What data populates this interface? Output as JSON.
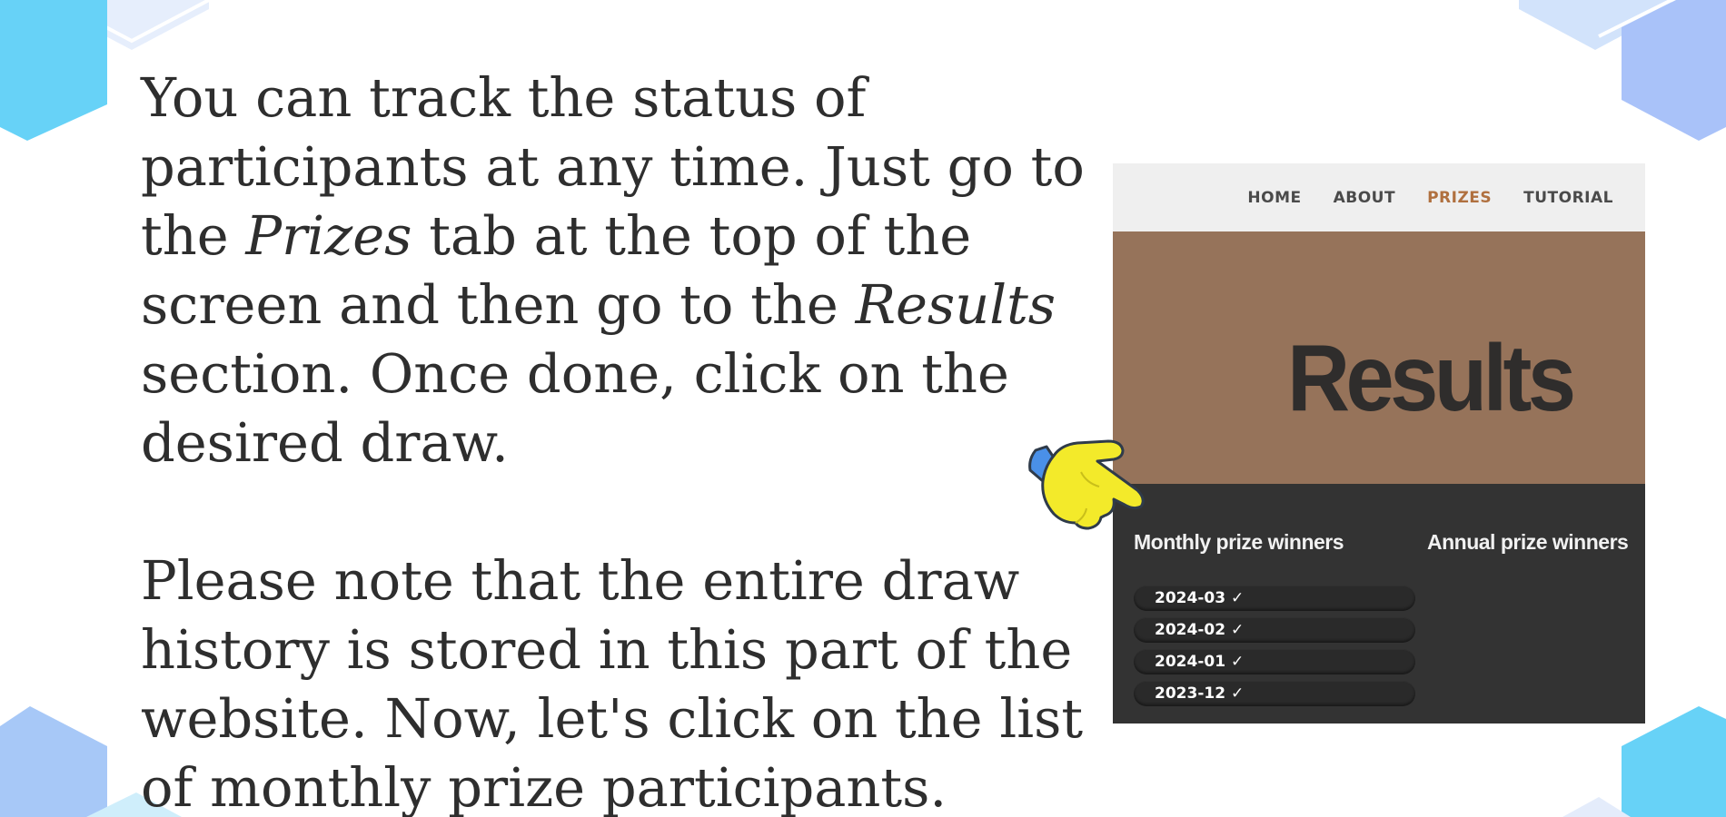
{
  "instructions": {
    "paragraph1": {
      "part1": "You can track the status of participants at any time. Just go to the ",
      "prizes_tab": "Prizes",
      "part2": " tab at the top of the screen and then go to the ",
      "results_section": "Results",
      "part3": " section. Once done, click on the desired draw."
    },
    "paragraph2": "Please note that the entire draw history is stored in this part of the website. Now, let's click on the list of monthly prize participants."
  },
  "embedded_screenshot": {
    "nav": {
      "items": [
        {
          "label": "HOME"
        },
        {
          "label": "ABOUT"
        },
        {
          "label": "PRIZES"
        },
        {
          "label": "TUTORIAL"
        }
      ],
      "active_item": "PRIZES"
    },
    "banner_title": "Results",
    "monthly_title": "Monthly prize winners",
    "annual_title": "Annual prize winners",
    "monthly_draws": [
      {
        "label": "2024-03 ✓"
      },
      {
        "label": "2024-02 ✓"
      },
      {
        "label": "2024-01 ✓"
      },
      {
        "label": "2023-12 ✓"
      }
    ]
  },
  "colors": {
    "text": "#2e2e2e",
    "nav_bg": "#efefef",
    "nav_active": "#b0703f",
    "banner_bg": "#96735a",
    "dark_panel": "#333333",
    "pointer_hand": "#f3ea2a",
    "pointer_cuff": "#4a90e8"
  },
  "icons": {
    "pointer": "pointing-hand-icon"
  }
}
